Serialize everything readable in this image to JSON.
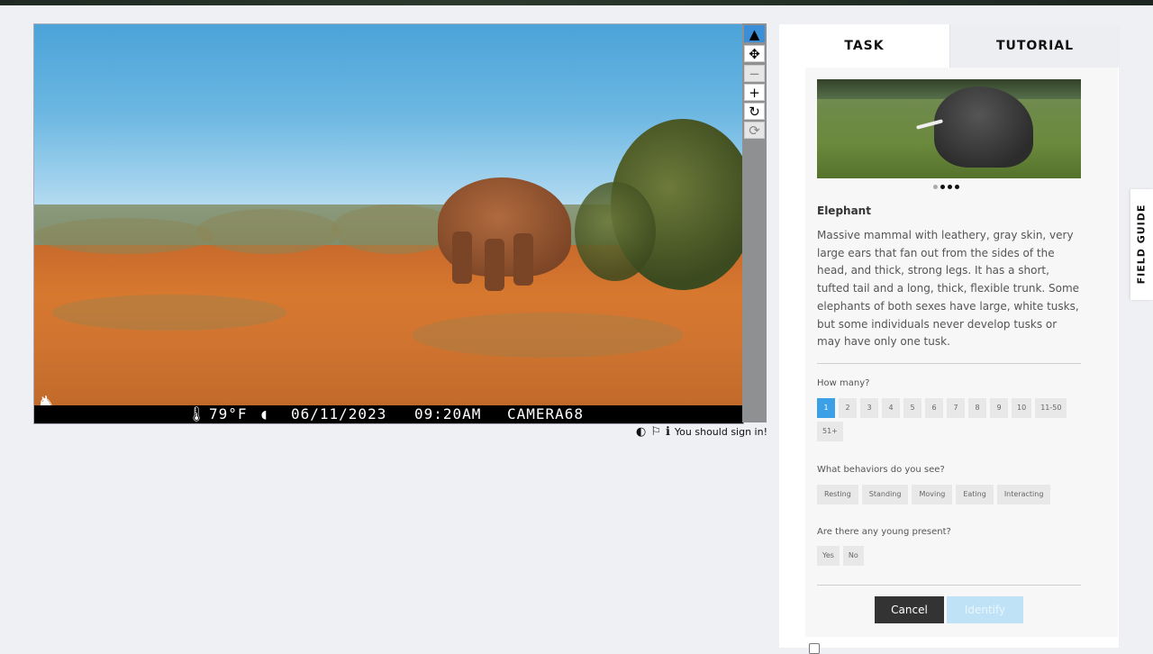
{
  "caption": {
    "temperature": "79°F",
    "date": "06/11/2023",
    "time": "09:20AM",
    "camera": "CAMERA68"
  },
  "tools": [
    {
      "name": "pointer",
      "icon": "▲"
    },
    {
      "name": "pan",
      "icon": "✥"
    },
    {
      "name": "zoom-out",
      "icon": "−"
    },
    {
      "name": "zoom-in",
      "icon": "+"
    },
    {
      "name": "rotate",
      "icon": "↻"
    },
    {
      "name": "reset",
      "icon": "⟳"
    }
  ],
  "meta": {
    "sign_in_text": "You should sign in!"
  },
  "tabs": {
    "task": "TASK",
    "tutorial": "TUTORIAL"
  },
  "species": {
    "name": "Elephant",
    "description": "Massive mammal with leathery, gray skin, very large ears that fan out from the sides of the head, and thick, strong legs. It has a short, tufted tail and a long, thick, flexible trunk. Some elephants of both sexes have large, white tusks, but some individuals never develop tusks or may have only one tusk."
  },
  "questions": {
    "how_many": {
      "label": "How many?",
      "options": [
        "1",
        "2",
        "3",
        "4",
        "5",
        "6",
        "7",
        "8",
        "9",
        "10",
        "11-50",
        "51+"
      ],
      "selected": "1"
    },
    "behaviors": {
      "label": "What behaviors do you see?",
      "options": [
        "Resting",
        "Standing",
        "Moving",
        "Eating",
        "Interacting"
      ]
    },
    "young": {
      "label": "Are there any young present?",
      "options": [
        "Yes",
        "No"
      ]
    }
  },
  "buttons": {
    "cancel": "Cancel",
    "identify": "Identify"
  },
  "field_guide": "FIELD GUIDE",
  "colors": {
    "accent": "#3ba0e6",
    "cancel_bg": "#333333",
    "identify_disabled": "#bfe2f6"
  }
}
